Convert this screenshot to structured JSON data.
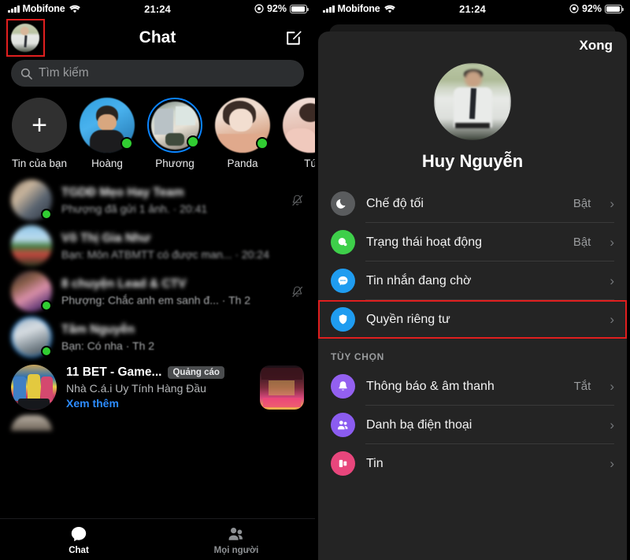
{
  "status_bar": {
    "carrier": "Mobifone",
    "time": "21:24",
    "battery": "92%",
    "wifi_icon": "wifi-icon",
    "signal_icon": "signal-bars-icon",
    "battery_icon": "battery-icon",
    "location_icon": "location-indicator-icon"
  },
  "left": {
    "header": {
      "title": "Chat",
      "avatar_name": "profile-avatar",
      "compose_icon": "compose-icon"
    },
    "search": {
      "placeholder": "Tìm kiếm",
      "icon": "search-icon"
    },
    "stories": [
      {
        "label": "Tin của bạn",
        "type": "add",
        "online": false,
        "ring": false
      },
      {
        "label": "Hoàng",
        "type": "photo",
        "online": true,
        "ring": false
      },
      {
        "label": "Phương",
        "type": "photo",
        "online": true,
        "ring": true
      },
      {
        "label": "Panda",
        "type": "photo",
        "online": true,
        "ring": false
      },
      {
        "label": "Tú",
        "type": "photo",
        "online": false,
        "ring": false
      }
    ],
    "chats": [
      {
        "name": "TGDĐ Mẹo Hay Team",
        "snippet": "Phượng đã gửi 1 ảnh. · 20:41",
        "muted": true,
        "online": true,
        "ring": false
      },
      {
        "name": "Võ Thị Gia Như",
        "snippet": "Bạn: Môn ATBMTT có được man... · 20:24",
        "muted": false,
        "online": false,
        "ring": false
      },
      {
        "name": "8 chuyện Lead & CTV",
        "snippet": "Phượng: Chắc anh em sanh đ... · Th 2",
        "muted": true,
        "online": true,
        "ring": false
      },
      {
        "name": "Tâm Nguyễn",
        "snippet": "Bạn: Có nha · Th 2",
        "muted": false,
        "online": true,
        "ring": true
      }
    ],
    "ad": {
      "title": "11 BET - Game...",
      "badge": "Quảng cáo",
      "subtitle": "Nhà C.á.i Uy Tính Hàng Đầu",
      "link": "Xem thêm"
    },
    "tabs": [
      {
        "label": "Chat",
        "icon": "chat-bubble-icon",
        "active": true
      },
      {
        "label": "Mọi người",
        "icon": "people-icon",
        "active": false
      }
    ]
  },
  "right": {
    "done_label": "Xong",
    "profile_name": "Huy Nguyễn",
    "settings": [
      {
        "label": "Chế độ tối",
        "value": "Bật",
        "icon": "moon-icon",
        "color": "#5a5c5e",
        "highlighted": false
      },
      {
        "label": "Trạng thái hoạt động",
        "value": "Bật",
        "icon": "active-status-icon",
        "color": "#3ecf4a",
        "highlighted": false
      },
      {
        "label": "Tin nhắn đang chờ",
        "value": "",
        "icon": "message-request-icon",
        "color": "#1f9cf0",
        "highlighted": false
      },
      {
        "label": "Quyền riêng tư",
        "value": "",
        "icon": "shield-icon",
        "color": "#1f9cf0",
        "highlighted": true
      }
    ],
    "options_header": "TÙY CHỌN",
    "options": [
      {
        "label": "Thông báo & âm thanh",
        "value": "Tắt",
        "icon": "bell-icon",
        "color": "#9360f0",
        "highlighted": false
      },
      {
        "label": "Danh bạ điện thoại",
        "value": "",
        "icon": "contacts-icon",
        "color": "#8b5cf0",
        "highlighted": false
      },
      {
        "label": "Tin",
        "value": "",
        "icon": "stories-icon",
        "color": "#e8467c",
        "highlighted": false
      }
    ],
    "chevron": "›"
  },
  "colors": {
    "accent_blue": "#0a84ff",
    "highlight_red": "#e01f1f",
    "online_green": "#31cd32",
    "sheet_bg": "#242424",
    "app_bg": "#000000"
  }
}
